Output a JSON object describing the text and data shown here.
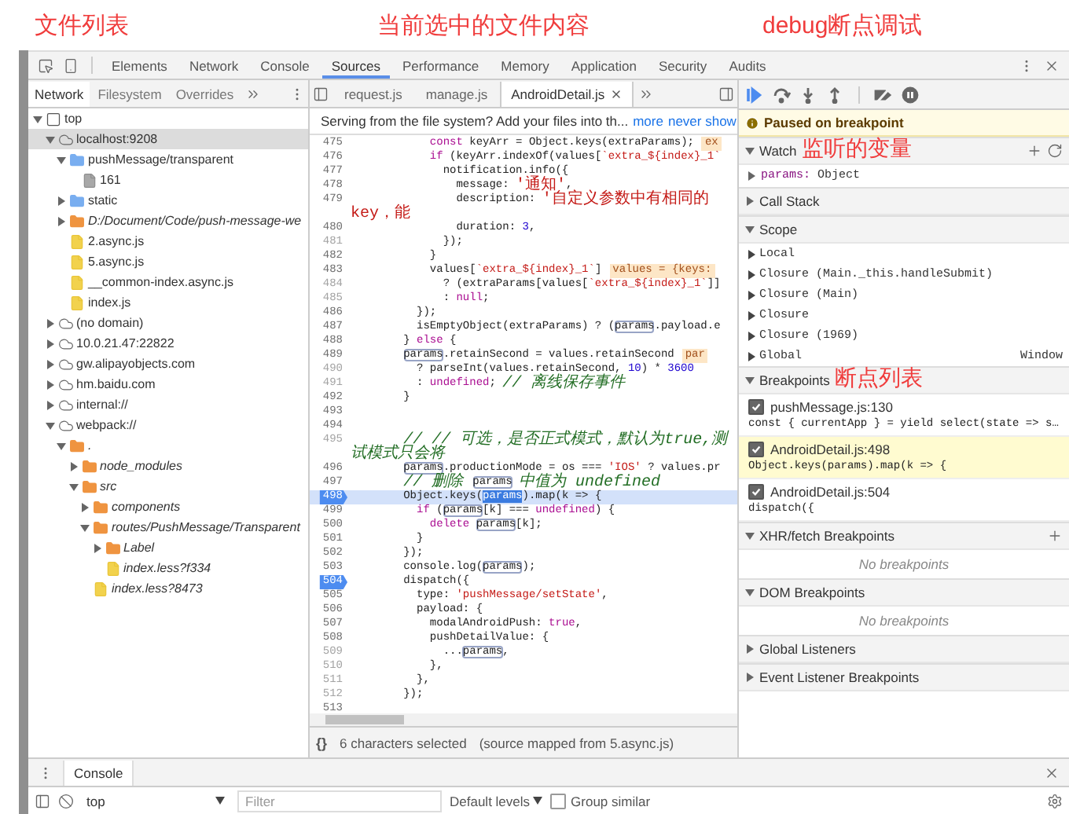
{
  "annotations": [
    "文件列表",
    "当前选中的文件内容",
    "debug断点调试"
  ],
  "main_tabs": [
    {
      "label": "Elements",
      "selected": false
    },
    {
      "label": "Network",
      "selected": false
    },
    {
      "label": "Console",
      "selected": false
    },
    {
      "label": "Sources",
      "selected": true
    },
    {
      "label": "Performance",
      "selected": false
    },
    {
      "label": "Memory",
      "selected": false
    },
    {
      "label": "Application",
      "selected": false
    },
    {
      "label": "Security",
      "selected": false
    },
    {
      "label": "Audits",
      "selected": false
    }
  ],
  "navigator": {
    "tabs": [
      {
        "label": "Network",
        "selected": true
      },
      {
        "label": "Filesystem",
        "selected": false
      },
      {
        "label": "Overrides",
        "selected": false
      }
    ],
    "tree": [
      {
        "label": "top",
        "kind": "frame",
        "expanded": true,
        "selected": false,
        "children": [
          {
            "label": "localhost:9208",
            "kind": "domain",
            "expanded": true,
            "selected": true,
            "children": [
              {
                "label": "pushMessage/transparent",
                "kind": "folder",
                "expanded": true,
                "selected": false,
                "children": [
                  {
                    "label": "161",
                    "kind": "page",
                    "selected": false
                  }
                ]
              },
              {
                "label": "static",
                "kind": "folder",
                "expanded": false,
                "selected": false
              },
              {
                "label": "D:/Document/Code/push-message-we",
                "kind": "fs-folder",
                "expanded": false,
                "selected": false
              },
              {
                "label": "2.async.js",
                "kind": "file",
                "selected": false
              },
              {
                "label": "5.async.js",
                "kind": "file",
                "selected": false
              },
              {
                "label": "__common-index.async.js",
                "kind": "file",
                "selected": false
              },
              {
                "label": "index.js",
                "kind": "file",
                "selected": false
              }
            ]
          },
          {
            "label": "(no domain)",
            "kind": "domain",
            "expanded": false,
            "selected": false
          },
          {
            "label": "10.0.21.47:22822",
            "kind": "domain",
            "expanded": false,
            "selected": false
          },
          {
            "label": "gw.alipayobjects.com",
            "kind": "domain",
            "expanded": false,
            "selected": false
          },
          {
            "label": "hm.baidu.com",
            "kind": "domain",
            "expanded": false,
            "selected": false
          },
          {
            "label": "internal://",
            "kind": "domain",
            "expanded": false,
            "selected": false
          },
          {
            "label": "webpack://",
            "kind": "domain",
            "expanded": true,
            "selected": false,
            "children": [
              {
                "label": ".",
                "kind": "fs-folder",
                "expanded": true,
                "selected": false,
                "children": [
                  {
                    "label": "node_modules",
                    "kind": "fs-folder",
                    "expanded": false,
                    "selected": false
                  },
                  {
                    "label": "src",
                    "kind": "fs-folder",
                    "expanded": true,
                    "selected": false,
                    "children": [
                      {
                        "label": "components",
                        "kind": "fs-folder",
                        "expanded": false,
                        "selected": false
                      },
                      {
                        "label": "routes/PushMessage/Transparent",
                        "kind": "fs-folder",
                        "expanded": true,
                        "selected": false,
                        "children": [
                          {
                            "label": "Label",
                            "kind": "fs-folder",
                            "expanded": false,
                            "selected": false
                          },
                          {
                            "label": "index.less?f334",
                            "kind": "fs-file",
                            "selected": false
                          }
                        ]
                      },
                      {
                        "label": "index.less?8473",
                        "kind": "fs-file",
                        "selected": false
                      }
                    ]
                  }
                ]
              }
            ]
          }
        ]
      }
    ]
  },
  "editor": {
    "tabs": [
      {
        "label": "request.js",
        "selected": false
      },
      {
        "label": "manage.js",
        "selected": false
      },
      {
        "label": "AndroidDetail.js",
        "selected": true
      }
    ],
    "infobar": {
      "message": "Serving from the file system? Add your files into th...",
      "links": [
        "more",
        "never show"
      ]
    },
    "lines": [
      {
        "number": "475",
        "mapped": true,
        "breakpoint": false,
        "current": false,
        "segments": [
          {
            "kind": "keyword",
            "text": "            const"
          },
          {
            "kind": "plain",
            "text": " keyArr = Object.keys(extraParams);"
          }
        ],
        "inline_value": "ex"
      },
      {
        "number": "476",
        "mapped": true,
        "breakpoint": false,
        "current": false,
        "segments": [
          {
            "kind": "keyword",
            "text": "            if"
          },
          {
            "kind": "plain",
            "text": " (keyArr.indexOf(values["
          },
          {
            "kind": "string",
            "text": "`extra_${index}_1`"
          }
        ]
      },
      {
        "number": "477",
        "mapped": true,
        "breakpoint": false,
        "current": false,
        "segments": [
          {
            "kind": "plain",
            "text": "              notification.info({"
          }
        ]
      },
      {
        "number": "478",
        "mapped": true,
        "breakpoint": false,
        "current": false,
        "segments": [
          {
            "kind": "plain",
            "text": "                message: "
          },
          {
            "kind": "string",
            "text": "'通知'"
          },
          {
            "kind": "plain",
            "text": ","
          }
        ]
      },
      {
        "number": "479",
        "mapped": true,
        "breakpoint": false,
        "current": false,
        "segments": [
          {
            "kind": "plain",
            "text": "                description: "
          },
          {
            "kind": "string",
            "text": "'自定义参数中有相同的key，能"
          }
        ]
      },
      {
        "number": "480",
        "mapped": true,
        "breakpoint": false,
        "current": false,
        "segments": [
          {
            "kind": "plain",
            "text": "                duration: "
          },
          {
            "kind": "number",
            "text": "3"
          },
          {
            "kind": "plain",
            "text": ","
          }
        ]
      },
      {
        "number": "481",
        "mapped": false,
        "breakpoint": false,
        "current": false,
        "segments": [
          {
            "kind": "plain",
            "text": "              });"
          }
        ]
      },
      {
        "number": "482",
        "mapped": true,
        "breakpoint": false,
        "current": false,
        "segments": [
          {
            "kind": "plain",
            "text": "            }"
          }
        ]
      },
      {
        "number": "483",
        "mapped": true,
        "breakpoint": false,
        "current": false,
        "segments": [
          {
            "kind": "plain",
            "text": "            values["
          },
          {
            "kind": "string",
            "text": "`extra_${index}_1`"
          },
          {
            "kind": "plain",
            "text": "]"
          }
        ],
        "inline_value": "values = {keys:"
      },
      {
        "number": "484",
        "mapped": false,
        "breakpoint": false,
        "current": false,
        "segments": [
          {
            "kind": "plain",
            "text": "              ? (extraParams[values["
          },
          {
            "kind": "string",
            "text": "`extra_${index}_1`"
          },
          {
            "kind": "plain",
            "text": "]]"
          }
        ]
      },
      {
        "number": "485",
        "mapped": false,
        "breakpoint": false,
        "current": false,
        "segments": [
          {
            "kind": "plain",
            "text": "              : "
          },
          {
            "kind": "keyword",
            "text": "null"
          },
          {
            "kind": "plain",
            "text": ";"
          }
        ]
      },
      {
        "number": "486",
        "mapped": true,
        "breakpoint": false,
        "current": false,
        "segments": [
          {
            "kind": "plain",
            "text": "          });"
          }
        ]
      },
      {
        "number": "487",
        "mapped": true,
        "breakpoint": false,
        "current": false,
        "segments": [
          {
            "kind": "plain",
            "text": "          isEmptyObject(extraParams) ? ("
          },
          {
            "kind": "ref",
            "text": "params"
          },
          {
            "kind": "plain",
            "text": ".payload.e"
          }
        ]
      },
      {
        "number": "488",
        "mapped": true,
        "breakpoint": false,
        "current": false,
        "segments": [
          {
            "kind": "plain",
            "text": "        } "
          },
          {
            "kind": "keyword",
            "text": "else"
          },
          {
            "kind": "plain",
            "text": " {"
          }
        ]
      },
      {
        "number": "489",
        "mapped": true,
        "breakpoint": false,
        "current": false,
        "segments": [
          {
            "kind": "ref",
            "text": "        params"
          },
          {
            "kind": "plain",
            "text": ".retainSecond = values.retainSecond"
          }
        ],
        "inline_value": "par"
      },
      {
        "number": "490",
        "mapped": false,
        "breakpoint": false,
        "current": false,
        "segments": [
          {
            "kind": "plain",
            "text": "          ? parseInt(values.retainSecond, "
          },
          {
            "kind": "number",
            "text": "10"
          },
          {
            "kind": "plain",
            "text": ") * "
          },
          {
            "kind": "number",
            "text": "3600"
          }
        ]
      },
      {
        "number": "491",
        "mapped": false,
        "breakpoint": false,
        "current": false,
        "segments": [
          {
            "kind": "plain",
            "text": "          : "
          },
          {
            "kind": "keyword",
            "text": "undefined"
          },
          {
            "kind": "plain",
            "text": "; "
          },
          {
            "kind": "comment",
            "text": "// 离线保存事件"
          }
        ]
      },
      {
        "number": "492",
        "mapped": true,
        "breakpoint": false,
        "current": false,
        "segments": [
          {
            "kind": "plain",
            "text": "        }"
          }
        ]
      },
      {
        "number": "493",
        "mapped": true,
        "breakpoint": false,
        "current": false
      },
      {
        "number": "494",
        "mapped": true,
        "breakpoint": false,
        "current": false
      },
      {
        "number": "495",
        "mapped": false,
        "breakpoint": false,
        "current": false,
        "segments": [
          {
            "kind": "comment",
            "text": "        // // 可选，是否正式模式，默认为true,测试模式只会将"
          }
        ]
      },
      {
        "number": "496",
        "mapped": true,
        "breakpoint": false,
        "current": false,
        "segments": [
          {
            "kind": "ref",
            "text": "        params"
          },
          {
            "kind": "plain",
            "text": ".productionMode = os === "
          },
          {
            "kind": "string",
            "text": "'IOS'"
          },
          {
            "kind": "plain",
            "text": " ? values.pr"
          }
        ]
      },
      {
        "number": "497",
        "mapped": true,
        "breakpoint": false,
        "current": false,
        "segments": [
          {
            "kind": "comment",
            "text": "        // 删除 "
          },
          {
            "kind": "ref",
            "text": "params"
          },
          {
            "kind": "comment",
            "text": " 中值为 undefined"
          }
        ]
      },
      {
        "number": "498",
        "mapped": true,
        "breakpoint": true,
        "current": true,
        "segments": [
          {
            "kind": "plain",
            "text": "        Object.keys("
          },
          {
            "kind": "selected",
            "text": "params"
          },
          {
            "kind": "plain",
            "text": ").map(k => {"
          }
        ]
      },
      {
        "number": "499",
        "mapped": true,
        "breakpoint": false,
        "current": false,
        "segments": [
          {
            "kind": "keyword",
            "text": "          if"
          },
          {
            "kind": "plain",
            "text": " ("
          },
          {
            "kind": "ref",
            "text": "params"
          },
          {
            "kind": "plain",
            "text": "[k] === "
          },
          {
            "kind": "keyword",
            "text": "undefined"
          },
          {
            "kind": "plain",
            "text": ") {"
          }
        ]
      },
      {
        "number": "500",
        "mapped": true,
        "breakpoint": false,
        "current": false,
        "segments": [
          {
            "kind": "keyword",
            "text": "            delete "
          },
          {
            "kind": "ref",
            "text": "params"
          },
          {
            "kind": "plain",
            "text": "[k];"
          }
        ]
      },
      {
        "number": "501",
        "mapped": true,
        "breakpoint": false,
        "current": false,
        "segments": [
          {
            "kind": "plain",
            "text": "          }"
          }
        ]
      },
      {
        "number": "502",
        "mapped": true,
        "breakpoint": false,
        "current": false,
        "segments": [
          {
            "kind": "plain",
            "text": "        });"
          }
        ]
      },
      {
        "number": "503",
        "mapped": true,
        "breakpoint": false,
        "current": false,
        "segments": [
          {
            "kind": "plain",
            "text": "        console.log("
          },
          {
            "kind": "ref",
            "text": "params"
          },
          {
            "kind": "plain",
            "text": ");"
          }
        ]
      },
      {
        "number": "504",
        "mapped": true,
        "breakpoint": true,
        "current": false,
        "segments": [
          {
            "kind": "plain",
            "text": "        dispatch({"
          }
        ]
      },
      {
        "number": "505",
        "mapped": true,
        "breakpoint": false,
        "current": false,
        "segments": [
          {
            "kind": "plain",
            "text": "          type: "
          },
          {
            "kind": "string",
            "text": "'pushMessage/setState'"
          },
          {
            "kind": "plain",
            "text": ","
          }
        ]
      },
      {
        "number": "506",
        "mapped": true,
        "breakpoint": false,
        "current": false,
        "segments": [
          {
            "kind": "plain",
            "text": "          payload: {"
          }
        ]
      },
      {
        "number": "507",
        "mapped": true,
        "breakpoint": false,
        "current": false,
        "segments": [
          {
            "kind": "plain",
            "text": "            modalAndroidPush: "
          },
          {
            "kind": "keyword",
            "text": "true"
          },
          {
            "kind": "plain",
            "text": ","
          }
        ]
      },
      {
        "number": "508",
        "mapped": true,
        "breakpoint": false,
        "current": false,
        "segments": [
          {
            "kind": "plain",
            "text": "            pushDetailValue: {"
          }
        ]
      },
      {
        "number": "509",
        "mapped": false,
        "breakpoint": false,
        "current": false,
        "segments": [
          {
            "kind": "plain",
            "text": "              ..."
          },
          {
            "kind": "ref",
            "text": "params"
          },
          {
            "kind": "plain",
            "text": ","
          }
        ]
      },
      {
        "number": "510",
        "mapped": false,
        "breakpoint": false,
        "current": false,
        "segments": [
          {
            "kind": "plain",
            "text": "            },"
          }
        ]
      },
      {
        "number": "511",
        "mapped": false,
        "breakpoint": false,
        "current": false,
        "segments": [
          {
            "kind": "plain",
            "text": "          },"
          }
        ]
      },
      {
        "number": "512",
        "mapped": false,
        "breakpoint": false,
        "current": false,
        "segments": [
          {
            "kind": "plain",
            "text": "        });"
          }
        ]
      },
      {
        "number": "513",
        "mapped": true,
        "breakpoint": false,
        "current": false
      }
    ],
    "footer": {
      "pretty_print": "{}",
      "selection": "6 characters selected",
      "source": "(source mapped from 5.async.js)"
    }
  },
  "debugger": {
    "paused": "Paused on breakpoint",
    "sections": [
      {
        "kind": "watch",
        "title": "Watch",
        "expanded": true,
        "annotation": "监听的变量",
        "items": [
          {
            "name": "params:",
            "value": "Object"
          }
        ]
      },
      {
        "kind": "plain",
        "title": "Call Stack",
        "expanded": false
      },
      {
        "kind": "scope",
        "title": "Scope",
        "expanded": true,
        "items": [
          {
            "label": "Local"
          },
          {
            "label": "Closure (Main._this.handleSubmit)"
          },
          {
            "label": "Closure (Main)"
          },
          {
            "label": "Closure"
          },
          {
            "label": "Closure (1969)"
          },
          {
            "label": "Global",
            "value": "Window"
          }
        ]
      },
      {
        "kind": "breakpoints",
        "title": "Breakpoints",
        "expanded": true,
        "annotation": "断点列表",
        "items": [
          {
            "location": "pushMessage.js:130",
            "code": "const { currentApp } = yield select(state => s…",
            "checked": true,
            "selected": false
          },
          {
            "location": "AndroidDetail.js:498",
            "code": "Object.keys(params).map(k => {",
            "checked": true,
            "selected": true
          },
          {
            "location": "AndroidDetail.js:504",
            "code": "dispatch({",
            "checked": true,
            "selected": false
          }
        ]
      },
      {
        "kind": "xhr",
        "title": "XHR/fetch Breakpoints",
        "expanded": true,
        "empty": "No breakpoints"
      },
      {
        "kind": "dom",
        "title": "DOM Breakpoints",
        "expanded": true,
        "empty": "No breakpoints"
      },
      {
        "kind": "plain",
        "title": "Global Listeners",
        "expanded": false
      },
      {
        "kind": "plain",
        "title": "Event Listener Breakpoints",
        "expanded": false
      }
    ]
  },
  "drawer": {
    "tabs": [
      {
        "label": "Console",
        "selected": true
      }
    ],
    "context": "top",
    "filter_placeholder": "Filter",
    "levels": "Default levels",
    "group_similar": {
      "label": "Group similar",
      "checked": false
    }
  }
}
